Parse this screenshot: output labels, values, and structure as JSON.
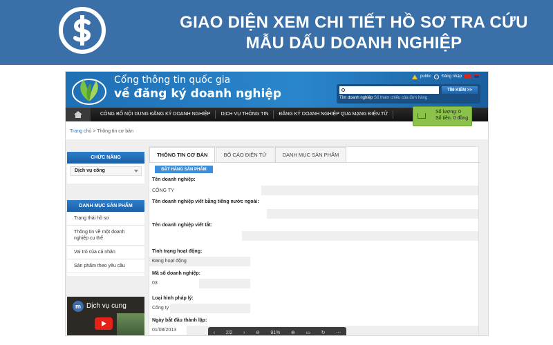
{
  "banner": {
    "title_line1": "GIAO DIỆN XEM CHI TIẾT HỒ SƠ TRA CỨU",
    "title_line2": "MẪU DẤU DOANH NGHIỆP"
  },
  "site": {
    "name_line1": "Cổng thông tin quốc gia",
    "name_line2": "về đăng ký doanh nghiệp",
    "top_links": [
      "public",
      "Đăng nhập"
    ],
    "search": {
      "placeholder": "",
      "button": "TÌM KIẾM >>",
      "tab_active": "Tìm doanh nghiệp",
      "tab_inactive": "Số tham chiếu của đơn hàng"
    },
    "nav": [
      "CÔNG BỐ NỘI DUNG ĐĂNG KÝ DOANH NGHIỆP",
      "DỊCH VỤ THÔNG TIN",
      "ĐĂNG KÝ DOANH NGHIỆP QUA MẠNG ĐIỆN TỬ"
    ],
    "cart": {
      "qty": "Số lượng: 0",
      "money": "Số tiền: 0 đồng"
    },
    "breadcrumb": {
      "home": "Trang chủ",
      "separator": " > ",
      "current": "Thông tin cơ bản"
    }
  },
  "sidebar": {
    "function_head": "CHỨC NĂNG",
    "function_select": "Dịch vụ công",
    "category_head": "DANH MỤC SẢN PHẨM",
    "items": [
      "Trạng thái hồ sơ",
      "Thông tin về một doanh nghiệp cụ thể",
      "Vai trò của cá nhân",
      "Sản phẩm theo yêu cầu"
    ],
    "video": {
      "avatar": "m",
      "title": "Dịch vụ cung"
    }
  },
  "main": {
    "tabs": [
      "THÔNG TIN CƠ BẢN",
      "BỐ CÁO ĐIỆN TỬ",
      "DANH MỤC SẢN PHẨM"
    ],
    "order_button": "ĐẶT HÀNG SẢN PHẨM",
    "fields": [
      {
        "label": "Tên doanh nghiệp:",
        "value": "CÔNG TY"
      },
      {
        "label": "Tên doanh nghiệp viết bằng tiếng nước ngoài:",
        "value": ""
      },
      {
        "label": "Tên doanh nghiệp viết tắt:",
        "value": ""
      },
      {
        "label": "Tình trạng hoạt động:",
        "value": "Đang hoạt động"
      },
      {
        "label": "Mã số doanh nghiệp:",
        "value": "03"
      },
      {
        "label": "Loại hình pháp lý:",
        "value": "Công ty"
      },
      {
        "label": "Ngày bắt đầu thành lập:",
        "value": "01/08/2013"
      }
    ]
  },
  "pdf_toolbar": {
    "page": "2/2",
    "zoom": "91%"
  }
}
